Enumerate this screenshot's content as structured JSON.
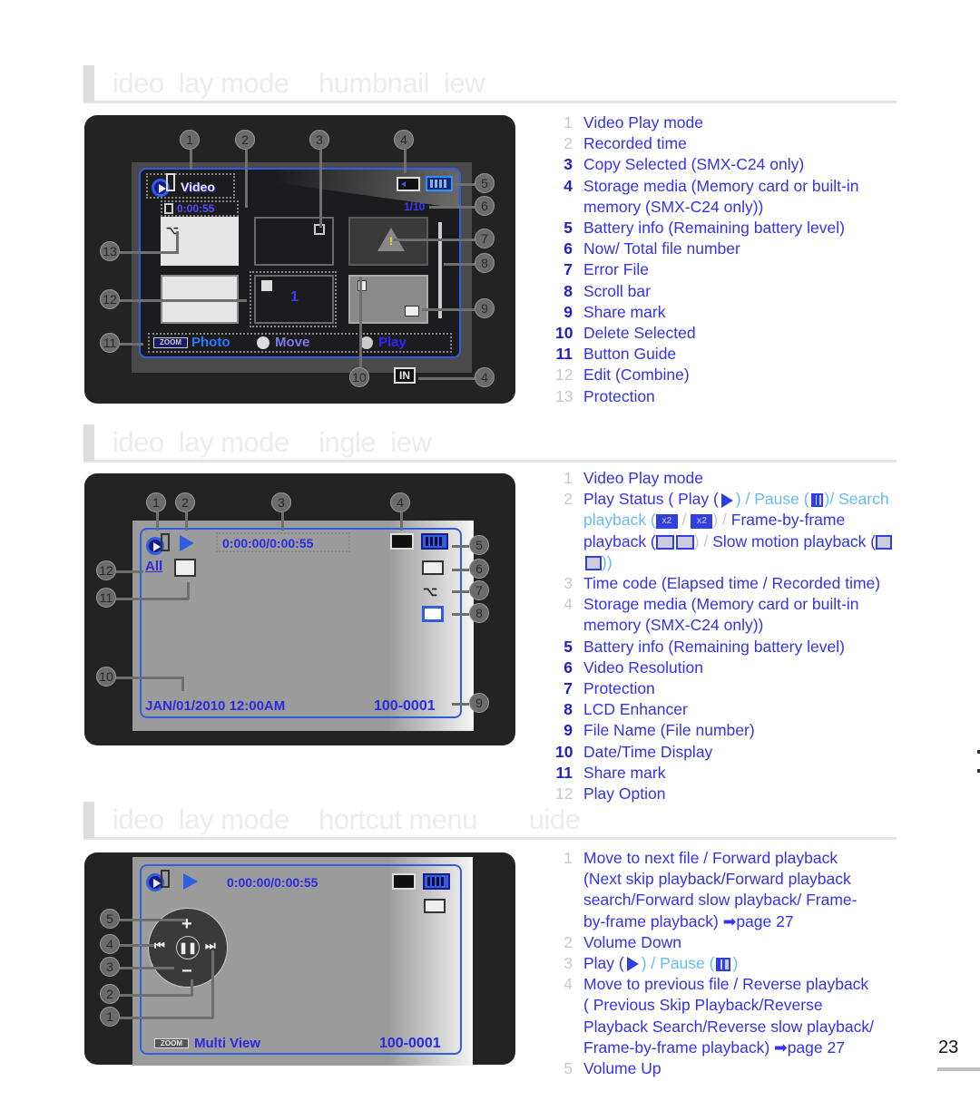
{
  "sections": [
    {
      "title": "ideo  lay mode    humbnail  iew",
      "screen": {
        "mode_label": "Video",
        "recorded_time": "0:00:55",
        "file_counter": "1/10",
        "combine_number": "1",
        "button_guide": {
          "zoom_badge": "ZOOM",
          "photo_label": "Photo",
          "move_label": "Move",
          "play_label": "Play"
        },
        "storage_badge": "IN",
        "callouts": [
          "1",
          "2",
          "3",
          "4",
          "5",
          "6",
          "7",
          "8",
          "9",
          "10",
          "11",
          "12",
          "13",
          "4"
        ]
      },
      "items": [
        {
          "num": "1",
          "text": "Video Play mode",
          "num_style": "light"
        },
        {
          "num": "2",
          "text": "Recorded time",
          "num_style": "light"
        },
        {
          "num": "3",
          "text": "Copy Selected (SMX-C24 only)",
          "num_style": "dark"
        },
        {
          "num": "4",
          "text": "Storage media (Memory card or built-in memory (SMX-C24 only))",
          "num_style": "dark"
        },
        {
          "num": "5",
          "text": "Battery info (Remaining battery level)",
          "num_style": "dark"
        },
        {
          "num": "6",
          "text": "Now/ Total file number",
          "num_style": "dark"
        },
        {
          "num": "7",
          "text": "Error File",
          "num_style": "dark"
        },
        {
          "num": "8",
          "text": "Scroll bar",
          "num_style": "dark"
        },
        {
          "num": "9",
          "text": "Share mark",
          "num_style": "dark"
        },
        {
          "num": "10",
          "text": "Delete Selected",
          "num_style": "dark"
        },
        {
          "num": "11",
          "text": "Button Guide",
          "num_style": "dark"
        },
        {
          "num": "12",
          "text": "Edit (Combine)",
          "num_style": "light"
        },
        {
          "num": "13",
          "text": "Protection",
          "num_style": "light"
        }
      ]
    },
    {
      "title": "ideo  lay mode    ingle  iew",
      "screen": {
        "time_code": "0:00:00/0:00:55",
        "play_option": "All",
        "date_time": "JAN/01/2010 12:00AM",
        "file_name": "100-0001",
        "callouts": [
          "1",
          "2",
          "3",
          "4",
          "5",
          "6",
          "7",
          "8",
          "9",
          "10",
          "11",
          "12"
        ]
      },
      "items": [
        {
          "num": "1",
          "text": "Video Play mode",
          "num_style": "light"
        },
        {
          "num": "2",
          "num_style": "light",
          "parts": {
            "a": "Play Status ( Play (",
            "b": ") / Pause (",
            "c": ")/",
            "d": "Search playback (",
            "e": " / ",
            "f": ") / ",
            "g": "Frame-by-frame playback (",
            "h": ") / ",
            "i": "Slow motion playback (",
            "j": "))"
          },
          "icons": {
            "play": "play-icon",
            "pause": "pause-icon",
            "search_rev": "x2 rewind",
            "search_fwd": "x2 forward",
            "frame_rev": "frame-back",
            "frame_fwd": "frame-forward",
            "slow_rev": "slow-back",
            "slow_fwd": "slow-forward"
          },
          "search_labels": {
            "rev": "x2",
            "fwd": "x2"
          }
        },
        {
          "num": "3",
          "text": "Time code (Elapsed time / Recorded time)",
          "num_style": "light"
        },
        {
          "num": "4",
          "text": "Storage media (Memory card or built-in memory (SMX-C24 only))",
          "num_style": "light"
        },
        {
          "num": "5",
          "text": "Battery info (Remaining battery level)",
          "num_style": "dark"
        },
        {
          "num": "6",
          "text": "Video Resolution",
          "num_style": "dark"
        },
        {
          "num": "7",
          "text": "Protection",
          "num_style": "dark"
        },
        {
          "num": "8",
          "text": "LCD Enhancer",
          "num_style": "dark"
        },
        {
          "num": "9",
          "text": "File Name (File number)",
          "num_style": "dark"
        },
        {
          "num": "10",
          "text": "Date/Time Display",
          "num_style": "dark"
        },
        {
          "num": "11",
          "text": "Share mark",
          "num_style": "dark"
        },
        {
          "num": "12",
          "text": "Play Option",
          "num_style": "light"
        }
      ]
    },
    {
      "title": "ideo  lay mode    hortcut menu       uide",
      "screen": {
        "time_code": "0:00:00/0:00:55",
        "zoom_badge": "ZOOM",
        "multi_view": "Multi View",
        "file_name": "100-0001",
        "callouts": [
          "5",
          "4",
          "3",
          "2",
          "1"
        ]
      },
      "items": [
        {
          "num": "1",
          "text": "Move to next file / Forward playback (Next skip playback/Forward playback search/Forward slow playback/ Frame-by-frame playback) ➡page 27",
          "num_style": "light"
        },
        {
          "num": "2",
          "text": "Volume Down",
          "num_style": "light"
        },
        {
          "num": "3",
          "num_style": "light",
          "parts": {
            "a": "Play (",
            "b": ") / Pause (",
            "c": ")"
          }
        },
        {
          "num": "4",
          "text": "Move to previous file / Reverse playback ( Previous Skip Playback/Reverse Playback Search/Reverse slow playback/ Frame-by-frame playback) ➡page 27",
          "num_style": "light"
        },
        {
          "num": "5",
          "text": "Volume Up",
          "num_style": "light"
        }
      ]
    }
  ],
  "page_number": "23",
  "colors": {
    "accent_blue": "#2f5fe0",
    "text_blue": "#3333ee",
    "light_blue": "#66bbee"
  }
}
